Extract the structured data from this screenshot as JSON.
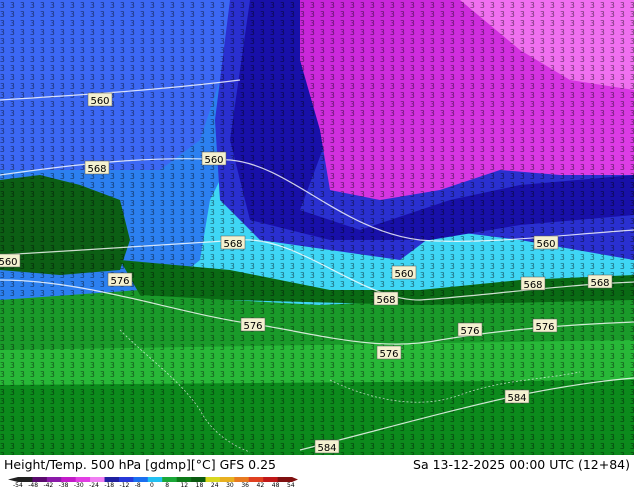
{
  "header": {
    "title_left": "Height/Temp. 500 hPa [gdmp][°C] GFS 0.25",
    "title_right": "Sa 13-12-2025 00:00 UTC (12+84)"
  },
  "map": {
    "contour_labels": [
      "560",
      "560",
      "568",
      "560",
      "568",
      "576",
      "576",
      "568",
      "560",
      "576",
      "568",
      "560",
      "576",
      "576",
      "568",
      "584",
      "584"
    ]
  },
  "legend": {
    "ticks": [
      "-54",
      "-48",
      "-42",
      "-38",
      "-30",
      "-24",
      "-18",
      "-12",
      "-8",
      "0",
      "8",
      "12",
      "18",
      "24",
      "30",
      "36",
      "42",
      "48",
      "54"
    ],
    "colors": [
      "#202020",
      "#5a0a6e",
      "#8a1aa8",
      "#c21bc9",
      "#e23ee4",
      "#f07ef2",
      "#2020a0",
      "#2838d8",
      "#1a6ff0",
      "#22c0f2",
      "#1aa838",
      "#0c7a18",
      "#0a5a10",
      "#d8d820",
      "#e8b020",
      "#e87a20",
      "#e04020",
      "#c01818",
      "#801010"
    ]
  }
}
